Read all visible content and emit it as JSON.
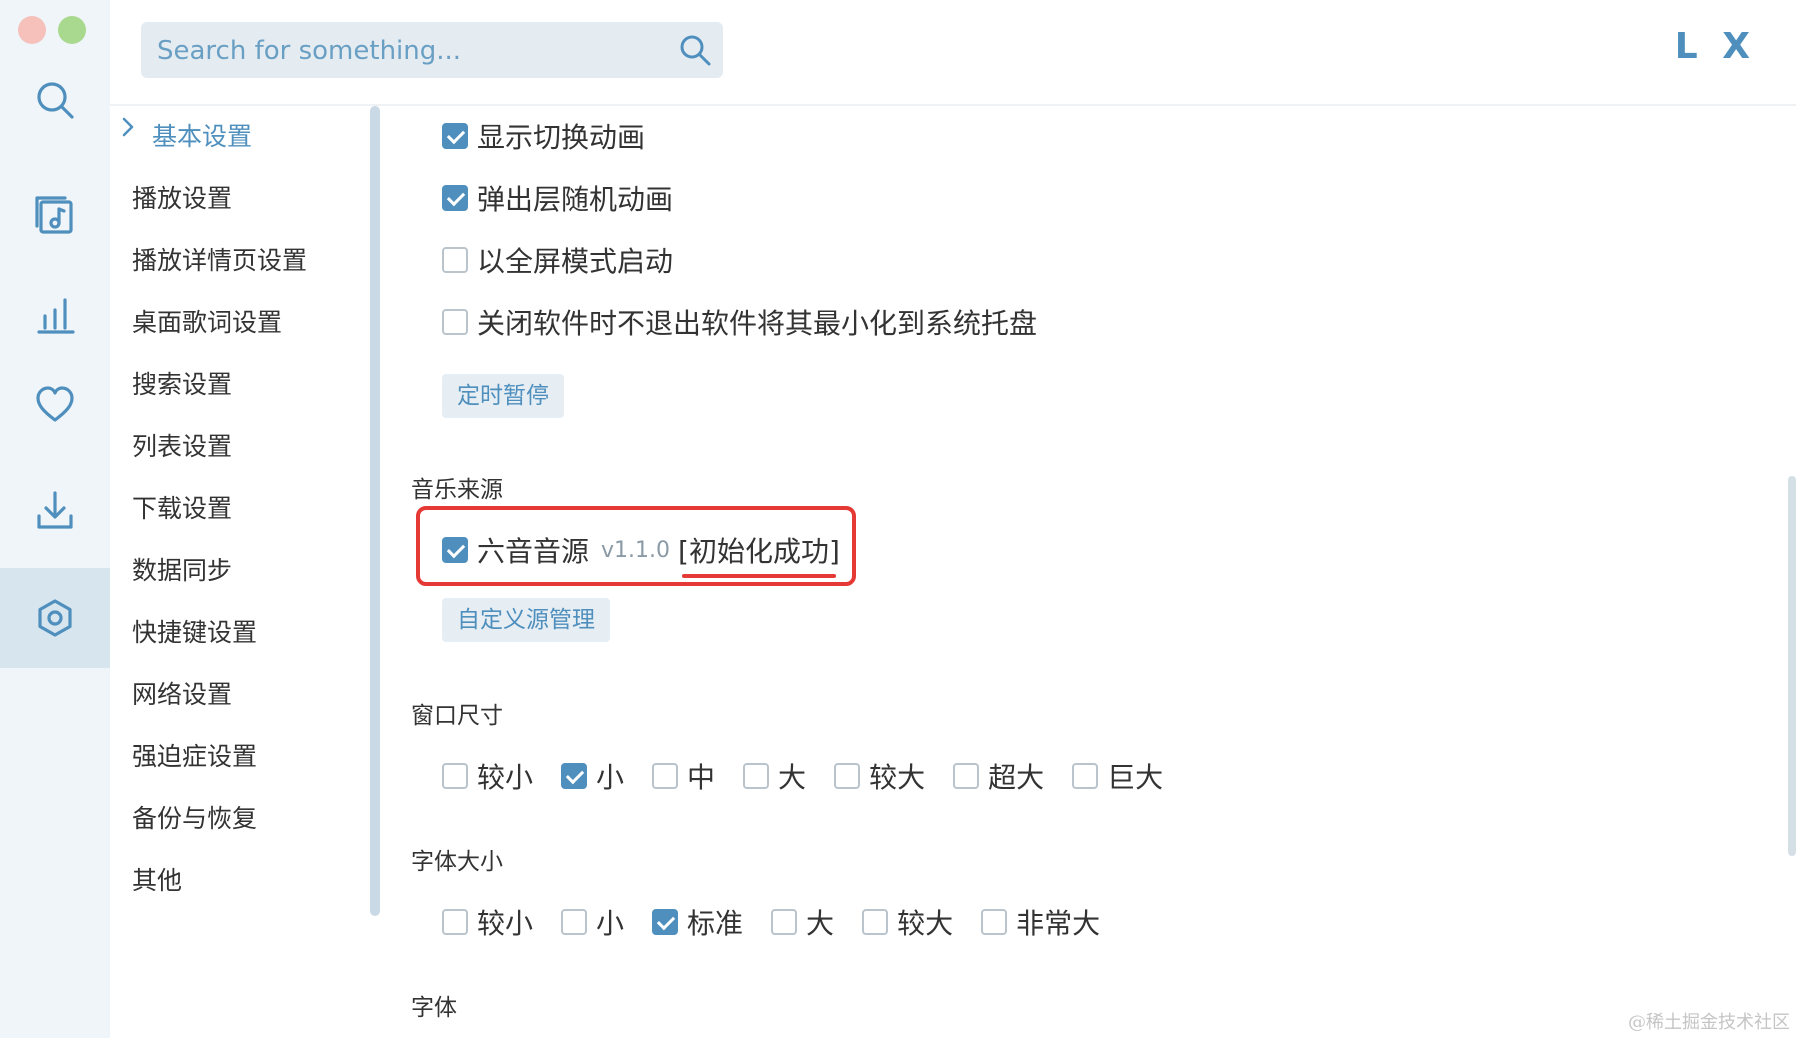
{
  "window": {
    "logo_text": "L X"
  },
  "search": {
    "placeholder": "Search for something..."
  },
  "rail": {
    "items": [
      {
        "icon": "search-icon"
      },
      {
        "icon": "music-list-icon"
      },
      {
        "icon": "chart-icon"
      },
      {
        "icon": "heart-icon"
      },
      {
        "icon": "download-icon"
      },
      {
        "icon": "settings-icon",
        "active": true
      }
    ]
  },
  "nav": {
    "items": [
      {
        "label": "基本设置",
        "active": true
      },
      {
        "label": "播放设置"
      },
      {
        "label": "播放详情页设置"
      },
      {
        "label": "桌面歌词设置"
      },
      {
        "label": "搜索设置"
      },
      {
        "label": "列表设置"
      },
      {
        "label": "下载设置"
      },
      {
        "label": "数据同步"
      },
      {
        "label": "快捷键设置"
      },
      {
        "label": "网络设置"
      },
      {
        "label": "强迫症设置"
      },
      {
        "label": "备份与恢复"
      },
      {
        "label": "其他"
      }
    ]
  },
  "basic": {
    "options": [
      {
        "label": "显示切换动画",
        "checked": true
      },
      {
        "label": "弹出层随机动画",
        "checked": true
      },
      {
        "label": "以全屏模式启动",
        "checked": false
      },
      {
        "label": "关闭软件时不退出软件将其最小化到系统托盘",
        "checked": false
      }
    ],
    "timer_button": "定时暂停"
  },
  "music_source": {
    "title": "音乐来源",
    "source_name": "六音音源",
    "version": "v1.1.0",
    "status": "[初始化成功]",
    "checked": true,
    "manage_button": "自定义源管理"
  },
  "window_size": {
    "title": "窗口尺寸",
    "options": [
      {
        "label": "较小",
        "checked": false
      },
      {
        "label": "小",
        "checked": true
      },
      {
        "label": "中",
        "checked": false
      },
      {
        "label": "大",
        "checked": false
      },
      {
        "label": "较大",
        "checked": false
      },
      {
        "label": "超大",
        "checked": false
      },
      {
        "label": "巨大",
        "checked": false
      }
    ]
  },
  "font_size": {
    "title": "字体大小",
    "options": [
      {
        "label": "较小",
        "checked": false
      },
      {
        "label": "小",
        "checked": false
      },
      {
        "label": "标准",
        "checked": true
      },
      {
        "label": "大",
        "checked": false
      },
      {
        "label": "较大",
        "checked": false
      },
      {
        "label": "非常大",
        "checked": false
      }
    ]
  },
  "font": {
    "title": "字体"
  },
  "watermark": "@稀土掘金技术社区",
  "colors": {
    "accent": "#4f8fbd",
    "highlight": "#e53935"
  }
}
